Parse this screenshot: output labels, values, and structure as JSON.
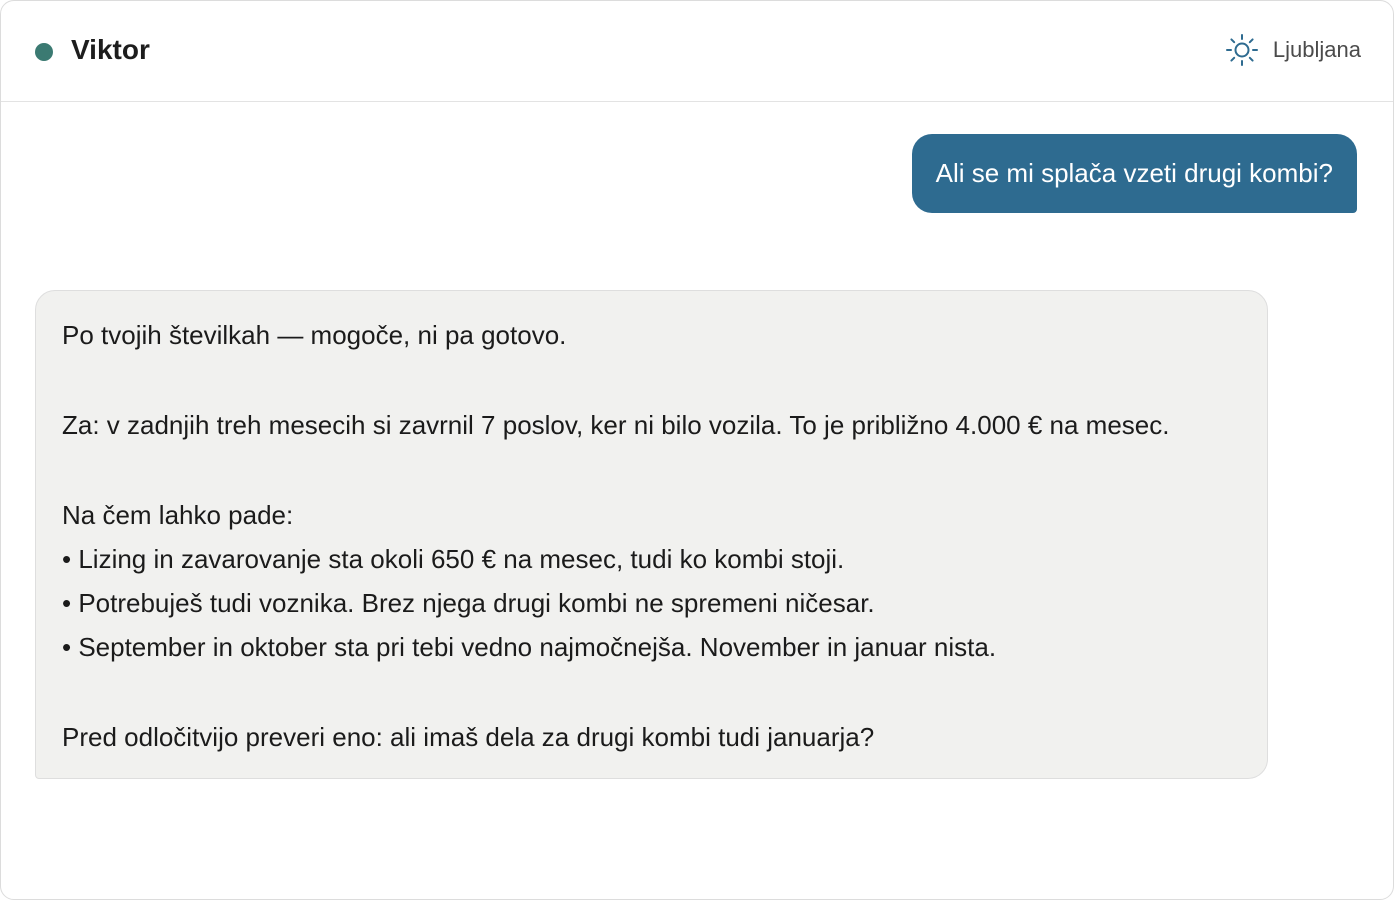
{
  "header": {
    "contact_name": "Viktor",
    "status_color": "#3b7a72",
    "location_icon": "sun-icon",
    "location": "Ljubljana"
  },
  "messages": {
    "user": "Ali se mi splača vzeti drugi kombi?",
    "assistant": {
      "intro": "Po tvojih številkah — mogoče, ni pa gotovo.",
      "pro": "Za: v zadnjih treh mesecih si zavrnil 7 poslov, ker ni bilo vozila. To je približno 4.000 € na mesec.",
      "cons_heading": "Na čem lahko pade:",
      "cons": [
        "• Lizing in zavarovanje sta okoli 650 € na mesec, tudi ko kombi stoji.",
        "• Potrebuješ tudi voznika. Brez njega drugi kombi ne spremeni ničesar.",
        "• September in oktober sta pri tebi vedno najmočnejša. November in januar nista."
      ],
      "closing": "Pred odločitvijo preveri eno: ali imaš dela za drugi kombi tudi januarja?"
    }
  },
  "colors": {
    "user_bubble": "#2e6b90",
    "assistant_bubble": "#f1f1ef"
  }
}
